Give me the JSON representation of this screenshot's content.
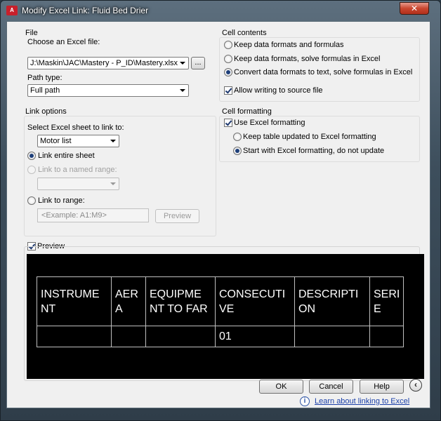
{
  "window": {
    "title": "Modify Excel Link: Fluid Bed Drier",
    "app_icon": "A",
    "close_glyph": "✕"
  },
  "file": {
    "group_title": "File",
    "choose_label": "Choose an Excel file:",
    "file_value": "J:\\Maskin\\JAC\\Mastery - P_ID\\Mastery.xlsx",
    "browse_label": "...",
    "path_type_label": "Path type:",
    "path_type_value": "Full path"
  },
  "link_options": {
    "group_title": "Link options",
    "select_sheet_label": "Select Excel sheet to link to:",
    "sheet_value": "Motor list",
    "link_entire_sheet": "Link entire sheet",
    "link_named_range": "Link to a named range:",
    "named_range_value": "",
    "link_to_range": "Link to range:",
    "range_placeholder": "<Example: A1:M9>",
    "preview_button": "Preview",
    "selected": "entire_sheet"
  },
  "cell_contents": {
    "group_title": "Cell contents",
    "opt_keep_formats_formulas": "Keep data formats and formulas",
    "opt_keep_formats_solve": "Keep data formats, solve formulas in Excel",
    "opt_convert_text": "Convert data formats to text, solve formulas in Excel",
    "selected": "convert_text",
    "allow_writing": "Allow writing to source file",
    "allow_writing_checked": true
  },
  "cell_formatting": {
    "group_title": "Cell formatting",
    "use_excel_formatting": "Use Excel formatting",
    "use_excel_formatting_checked": true,
    "opt_keep_updated": "Keep table updated to Excel formatting",
    "opt_start_with": "Start with Excel formatting, do not update",
    "selected": "start_with"
  },
  "preview": {
    "label": "Preview",
    "checked": true,
    "rows": [
      [
        "INSTRUME NT",
        "AER A",
        "EQUIPME NT TO FAR",
        "CONSECUTI VE",
        "DESCRIPTI ON",
        "SERI E"
      ],
      [
        "",
        "",
        "",
        "01",
        "",
        ""
      ]
    ]
  },
  "buttons": {
    "ok": "OK",
    "cancel": "Cancel",
    "help": "Help",
    "collapse_glyph": "‹"
  },
  "footer": {
    "info_glyph": "i",
    "learn_link": "Learn about linking to Excel"
  }
}
